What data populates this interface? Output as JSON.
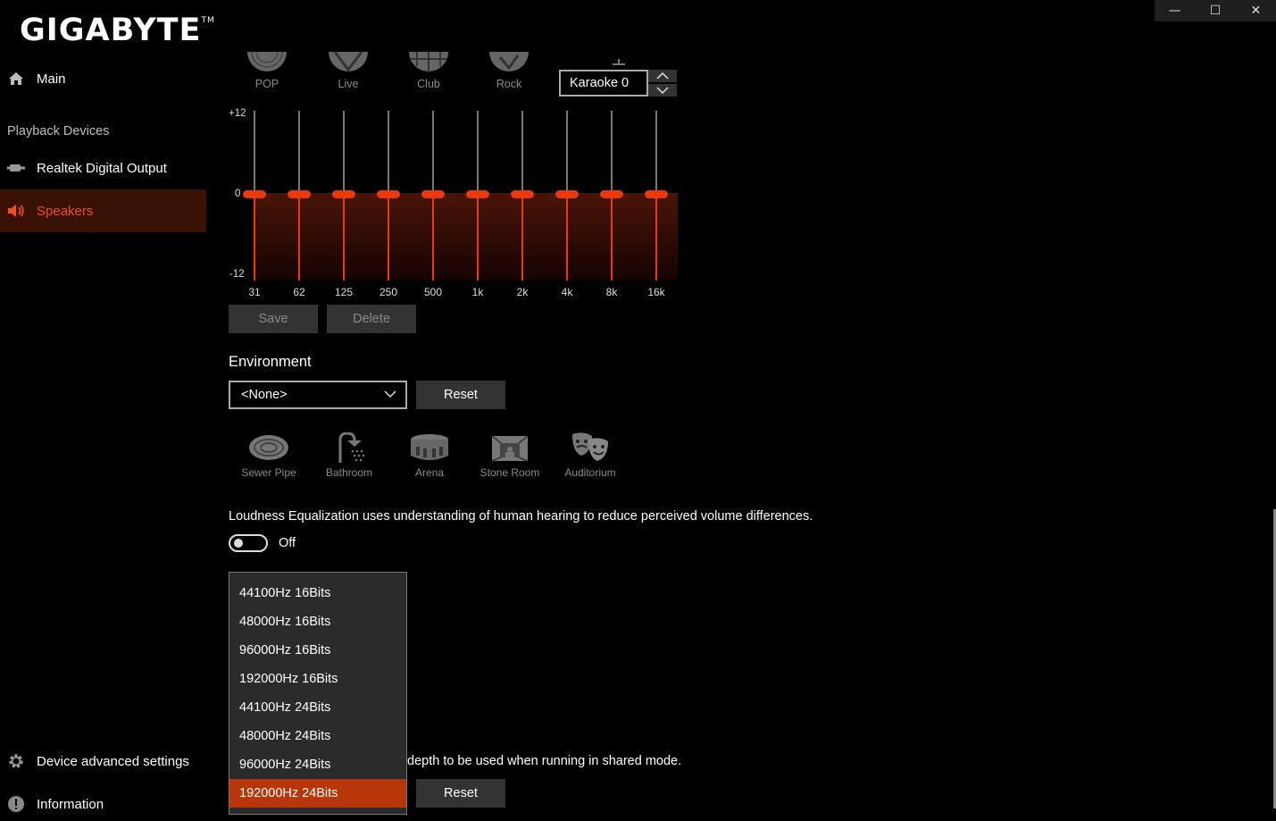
{
  "window": {
    "minimize_glyph": "—",
    "maximize_glyph": "☐",
    "close_glyph": "✕"
  },
  "sidebar": {
    "logo": "GIGABYTE",
    "logo_tm": "TM",
    "main_label": "Main",
    "section_label": "Playback Devices",
    "devices": [
      {
        "label": "Realtek Digital Output",
        "icon": "digital-output-icon"
      },
      {
        "label": "Speakers",
        "icon": "speaker-icon",
        "active": true
      }
    ],
    "advanced_label": "Device advanced settings",
    "info_label": "Information"
  },
  "equalizer": {
    "presets": [
      "POP",
      "Live",
      "Club",
      "Rock"
    ],
    "selected_preset": "Karaoke 0",
    "scale": {
      "max": "+12",
      "mid": "0",
      "min": "-12"
    },
    "bands": [
      {
        "label": "31",
        "value": 0
      },
      {
        "label": "62",
        "value": 0
      },
      {
        "label": "125",
        "value": 0
      },
      {
        "label": "250",
        "value": 0
      },
      {
        "label": "500",
        "value": 0
      },
      {
        "label": "1k",
        "value": 0
      },
      {
        "label": "2k",
        "value": 0
      },
      {
        "label": "4k",
        "value": 0
      },
      {
        "label": "8k",
        "value": 0
      },
      {
        "label": "16k",
        "value": 0
      }
    ],
    "save_label": "Save",
    "delete_label": "Delete"
  },
  "environment": {
    "title": "Environment",
    "selected": "<None>",
    "reset_label": "Reset",
    "presets": [
      "Sewer Pipe",
      "Bathroom",
      "Arena",
      "Stone Room",
      "Auditorium"
    ]
  },
  "loudness": {
    "description": "Loudness Equalization uses understanding of human hearing to reduce perceived volume differences.",
    "state_label": "Off"
  },
  "format": {
    "description_partial": "depth to be used when running in shared mode.",
    "reset_label": "Reset",
    "options": [
      "44100Hz 16Bits",
      "48000Hz 16Bits",
      "96000Hz 16Bits",
      "192000Hz 16Bits",
      "44100Hz 24Bits",
      "48000Hz 24Bits",
      "96000Hz 24Bits",
      "192000Hz 24Bits"
    ],
    "selected_index": 7
  },
  "colors": {
    "accent": "#e83a10",
    "active_bg": "#3a1105",
    "selected_item": "#b8360a"
  }
}
